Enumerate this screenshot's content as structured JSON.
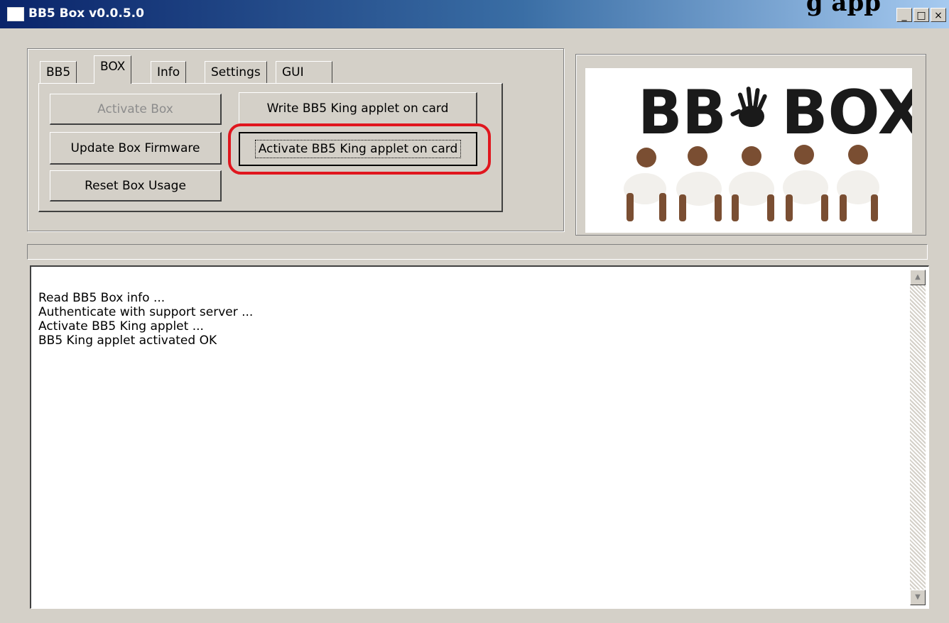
{
  "window": {
    "title": "BB5 Box v0.0.5.0",
    "overlay_caption": "g app",
    "controls": {
      "minimize": "_",
      "maximize": "□",
      "close": "×"
    }
  },
  "tabs": [
    {
      "label": "BB5",
      "selected": false
    },
    {
      "label": "BOX",
      "selected": true
    },
    {
      "label": "Info",
      "selected": false
    },
    {
      "label": "Settings",
      "selected": false
    },
    {
      "label": "GUI",
      "selected": false
    }
  ],
  "box_tab": {
    "activate_box": "Activate Box",
    "update_firmware": "Update Box Firmware",
    "reset_usage": "Reset Box Usage",
    "write_applet": "Write BB5 King applet on card",
    "activate_applet": "Activate BB5 King applet on card"
  },
  "logo": {
    "text_left": "BB",
    "text_right": "BOX",
    "hand_icon": "hand-print-icon"
  },
  "progress": {
    "value": 0
  },
  "log": {
    "lines": [
      "Read BB5 Box info ...",
      "Authenticate with support server ...",
      "Activate BB5 King applet ...",
      "BB5 King applet activated OK"
    ]
  },
  "colors": {
    "highlight": "#e0161e",
    "titlebar": "#0a246a",
    "face": "#d4d0c8"
  }
}
